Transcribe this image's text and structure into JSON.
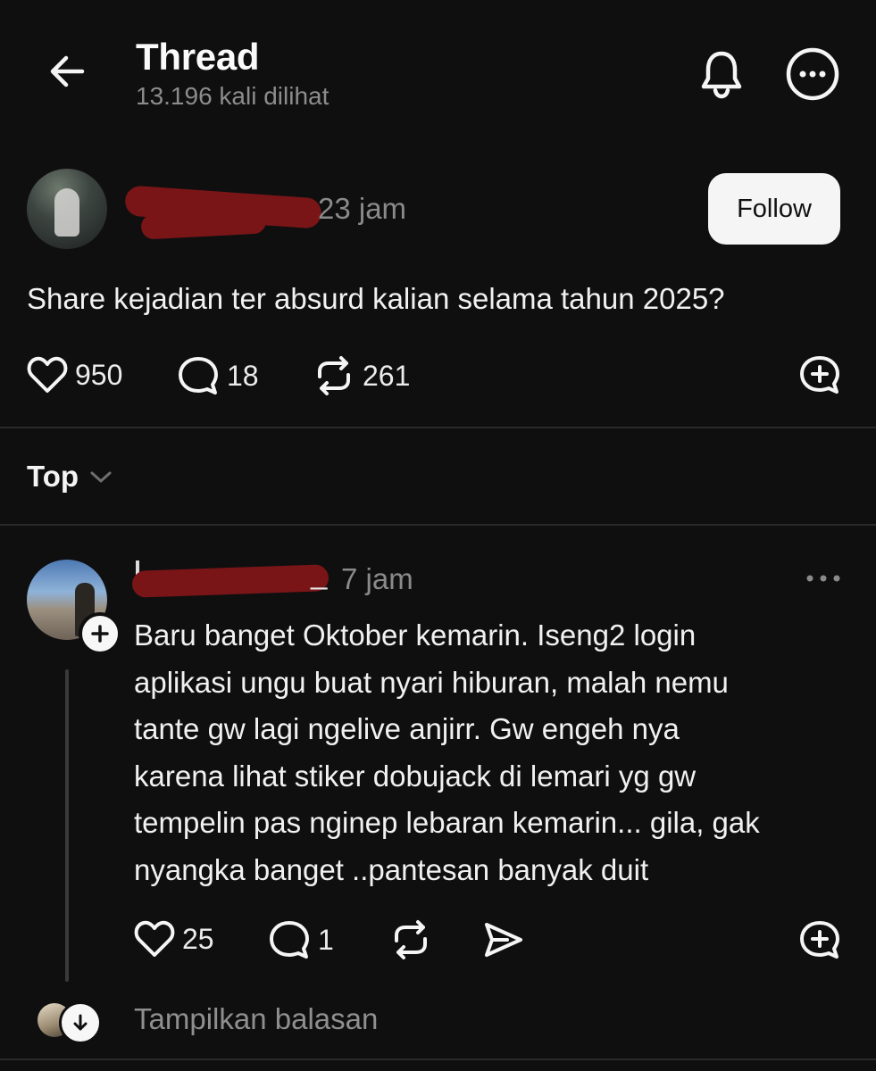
{
  "header": {
    "title": "Thread",
    "views": "13.196 kali dilihat"
  },
  "post": {
    "time": "23 jam",
    "follow_label": "Follow",
    "text": "Share kejadian ter absurd kalian selama tahun 2025?",
    "likes": "950",
    "comments": "18",
    "reposts": "261"
  },
  "sort": {
    "label": "Top"
  },
  "reply": {
    "username_fragment": "_",
    "time": "7 jam",
    "text": "Baru banget Oktober kemarin. Iseng2 login\naplikasi ungu buat nyari hiburan, malah nemu\ntante gw lagi ngelive anjirr. Gw engeh nya\nkarena lihat stiker dobujack di lemari yg gw\ntempelin pas nginep lebaran kemarin... gila, gak\nnyangka banget ..pantesan banyak duit",
    "likes": "25",
    "comments": "1"
  },
  "show_replies_label": "Tampilkan balasan",
  "icons": {
    "back": "arrow-left-icon",
    "bell": "bell-icon",
    "more": "more-circle-icon",
    "like": "heart-icon",
    "comment": "comment-icon",
    "repost": "repost-icon",
    "share": "send-icon",
    "quote": "quote-plus-icon"
  },
  "colors": {
    "background": "#0f0f10",
    "text": "#f3f3f3",
    "muted": "#8a8a8a",
    "follow_bg": "#f5f5f5",
    "redaction": "#7a1517"
  }
}
